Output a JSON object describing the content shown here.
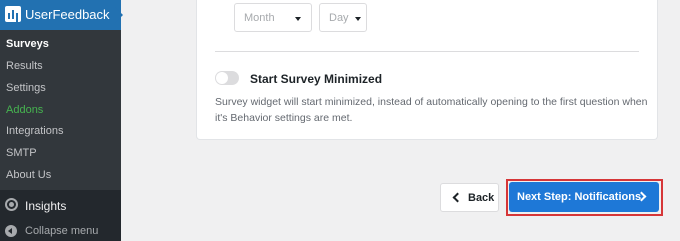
{
  "sidebar": {
    "title": "UserFeedback",
    "items": [
      {
        "label": "Surveys"
      },
      {
        "label": "Results"
      },
      {
        "label": "Settings"
      },
      {
        "label": "Addons"
      },
      {
        "label": "Integrations"
      },
      {
        "label": "SMTP"
      },
      {
        "label": "About Us"
      }
    ],
    "insights_label": "Insights",
    "collapse_label": "Collapse menu"
  },
  "form": {
    "month_placeholder": "Month",
    "day_placeholder": "Day",
    "toggle_title": "Start Survey Minimized",
    "toggle_on": false,
    "toggle_description": "Survey widget will start minimized, instead of automatically opening to the first question when it's Behavior settings are met."
  },
  "actions": {
    "back_label": "Back",
    "next_label": "Next Step: Notifications"
  },
  "colors": {
    "sidebar_bg": "#23282d",
    "accent": "#2271b1",
    "next_button": "#1e78d7",
    "highlight_outline": "#d63638",
    "addons_green": "#46b450"
  },
  "icons": {
    "brand": "userfeedback-logo-icon",
    "insights": "insights-icon",
    "collapse": "collapse-menu-icon"
  }
}
